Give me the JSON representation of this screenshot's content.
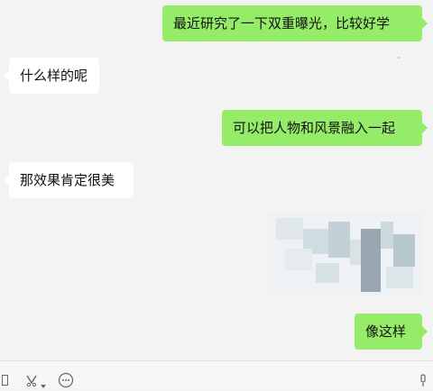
{
  "messages": [
    {
      "side": "right",
      "text": "最近研究了一下双重曝光，比较好学"
    },
    {
      "side": "left",
      "text": "什么样的呢"
    },
    {
      "side": "right",
      "text": "可以把人物和风景融入一起"
    },
    {
      "side": "left",
      "text": "那效果肯定很美"
    },
    {
      "side": "right",
      "type": "image",
      "description": "blurred mosaic photo"
    },
    {
      "side": "right",
      "text": "像这样"
    }
  ],
  "toolbar": {
    "icons": [
      "window-icon",
      "scissors-icon",
      "chevron-down-icon",
      "emoji-icon",
      "microphone-icon"
    ]
  },
  "colors": {
    "bubble_me": "#95ec69",
    "bubble_other": "#ffffff",
    "background": "#f3f3f3"
  }
}
